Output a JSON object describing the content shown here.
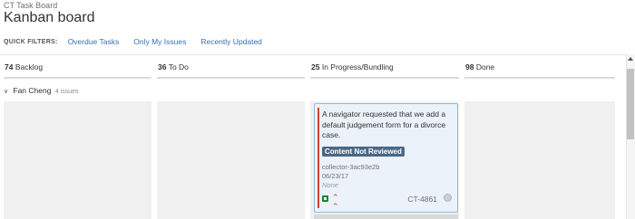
{
  "header": {
    "breadcrumb": "CT Task Board",
    "title": "Kanban board"
  },
  "quick_filters": {
    "label": "QUICK FILTERS:",
    "items": [
      "Overdue Tasks",
      "Only My Issues",
      "Recently Updated"
    ]
  },
  "columns": [
    {
      "count": "74",
      "name": "Backlog"
    },
    {
      "count": "36",
      "name": "To Do"
    },
    {
      "count": "25",
      "name": "In Progress/Bundling"
    },
    {
      "count": "98",
      "name": "Done"
    }
  ],
  "swimlane": {
    "name": "Fan Cheng",
    "issues": "4 issues"
  },
  "card": {
    "summary": "A navigator requested that we add a default judgement form for a divorce case.",
    "status_badge": "Content Not Reviewed",
    "reporter": "collector-3ac93e2b",
    "date": "06/23/17",
    "assignee_field": "None",
    "key": "CT-4861",
    "issue_type_icon": "story-icon",
    "priority_icon": "priority-highest-icon",
    "colors": {
      "priority_bar": "#d04437",
      "badge": "#4a6785",
      "card_bg": "#ebf2f9"
    }
  }
}
